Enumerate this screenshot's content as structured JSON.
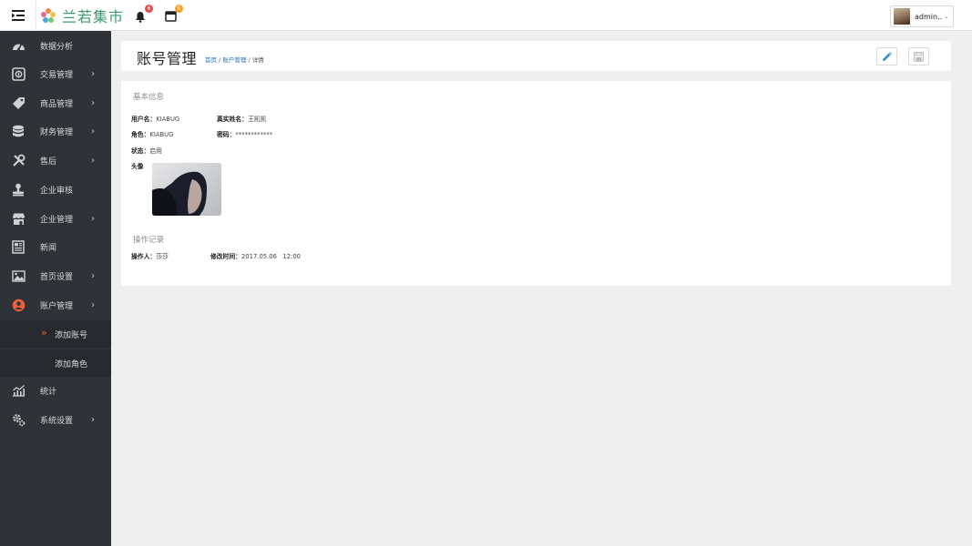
{
  "topbar": {
    "brand_name": "兰若集市",
    "notifications_count": "6",
    "messages_count": "6",
    "user_name": "admin..."
  },
  "sidebar": {
    "items": [
      {
        "label": "数据分析",
        "icon": "dashboard-icon",
        "has_arrow": false
      },
      {
        "label": "交易管理",
        "icon": "exchange-icon",
        "has_arrow": true
      },
      {
        "label": "商品管理",
        "icon": "tag-icon",
        "has_arrow": true
      },
      {
        "label": "财务管理",
        "icon": "database-icon",
        "has_arrow": true
      },
      {
        "label": "售后",
        "icon": "tools-icon",
        "has_arrow": true
      },
      {
        "label": "企业审核",
        "icon": "stamp-icon",
        "has_arrow": false
      },
      {
        "label": "企业管理",
        "icon": "store-icon",
        "has_arrow": true
      },
      {
        "label": "新闻",
        "icon": "newspaper-icon",
        "has_arrow": false
      },
      {
        "label": "首页设置",
        "icon": "image-settings-icon",
        "has_arrow": true
      },
      {
        "label": "账户管理",
        "icon": "user-circle-icon",
        "has_arrow": true
      },
      {
        "label": "统计",
        "icon": "chart-line-icon",
        "has_arrow": false
      },
      {
        "label": "系统设置",
        "icon": "gears-icon",
        "has_arrow": true
      }
    ],
    "sub_items": [
      {
        "label": "添加账号",
        "active": true
      },
      {
        "label": "添加角色",
        "active": false
      }
    ]
  },
  "header": {
    "title": "账号管理",
    "breadcrumb": [
      "首页",
      "账户管理",
      "详情"
    ],
    "separator": "/"
  },
  "basic_info": {
    "section_title": "基本信息",
    "username_label": "用户名：",
    "username": "KIABUG",
    "realname_label": "真实姓名：",
    "realname": "王凯凯",
    "role_label": "角色：",
    "role": "KIABUG",
    "password_label": "密码：",
    "password": "************",
    "status_label": "状态：",
    "status": "启用",
    "avatar_label": "头像"
  },
  "operation_log": {
    "section_title": "操作记录",
    "operator_label": "操作人：",
    "operator": "莎莎",
    "modified_label": "修改时间：",
    "modified_time": "2017.05.06   12:00"
  },
  "colors": {
    "sidebar_bg": "#2f3338",
    "accent_red": "#e8603c",
    "brand_green": "#3e9a6f",
    "link_blue": "#2a72b8",
    "edit_blue": "#2a8ad4"
  }
}
